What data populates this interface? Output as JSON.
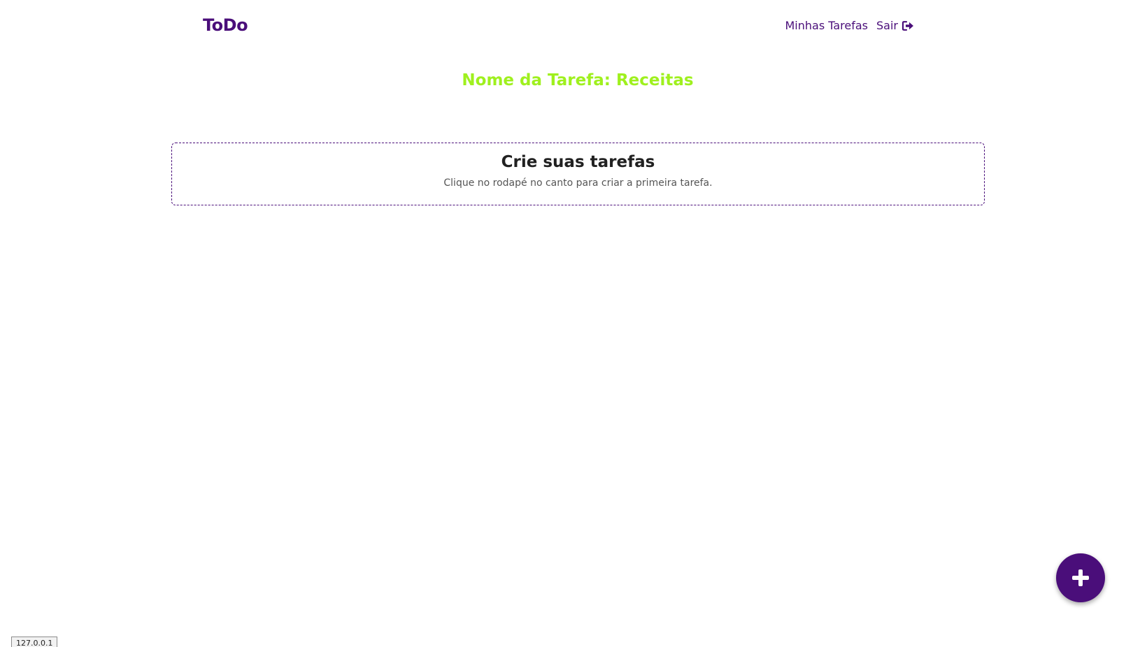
{
  "navbar": {
    "brand": "ToDo",
    "links": {
      "my_tasks": "Minhas Tarefas",
      "logout": "Sair"
    },
    "logout_icon": "sign-out-icon"
  },
  "main": {
    "title": "Nome da Tarefa: Receitas",
    "empty_state": {
      "heading": "Crie suas tarefas",
      "text": "Clique no rodapé no canto para criar a primeira tarefa."
    }
  },
  "fab": {
    "icon": "plus-icon"
  },
  "status_bar": {
    "url": "127.0.0.1"
  },
  "colors": {
    "brand": "#4a0e7a",
    "title": "#9ff01e",
    "text": "#212121",
    "background": "#ffffff"
  }
}
